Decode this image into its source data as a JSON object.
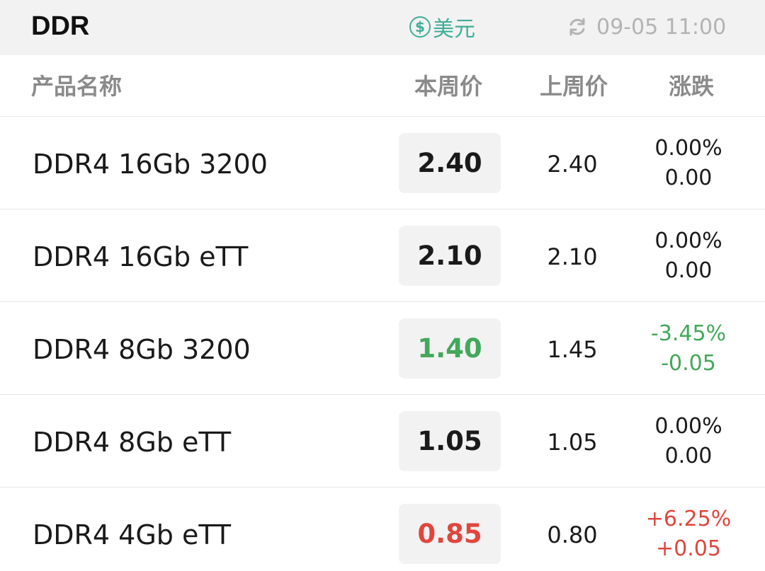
{
  "header": {
    "title": "DDR",
    "currency_symbol": "$",
    "currency_label": "美元",
    "refresh_icon": "refresh-icon",
    "timestamp": "09-05 11:00"
  },
  "columns": {
    "name": "产品名称",
    "current": "本周价",
    "previous": "上周价",
    "change": "涨跌"
  },
  "colors": {
    "accent": "#3fae96",
    "down": "#43a85a",
    "up": "#e0463c",
    "neutral": "#1a1a1a"
  },
  "rows": [
    {
      "name": "DDR4 16Gb 3200",
      "current": "2.40",
      "previous": "2.40",
      "change_pct": "0.00%",
      "change_abs": "0.00",
      "trend": "neutral"
    },
    {
      "name": "DDR4 16Gb eTT",
      "current": "2.10",
      "previous": "2.10",
      "change_pct": "0.00%",
      "change_abs": "0.00",
      "trend": "neutral"
    },
    {
      "name": "DDR4 8Gb 3200",
      "current": "1.40",
      "previous": "1.45",
      "change_pct": "-3.45%",
      "change_abs": "-0.05",
      "trend": "down"
    },
    {
      "name": "DDR4 8Gb eTT",
      "current": "1.05",
      "previous": "1.05",
      "change_pct": "0.00%",
      "change_abs": "0.00",
      "trend": "neutral"
    },
    {
      "name": "DDR4 4Gb eTT",
      "current": "0.85",
      "previous": "0.80",
      "change_pct": "+6.25%",
      "change_abs": "+0.05",
      "trend": "up"
    }
  ]
}
